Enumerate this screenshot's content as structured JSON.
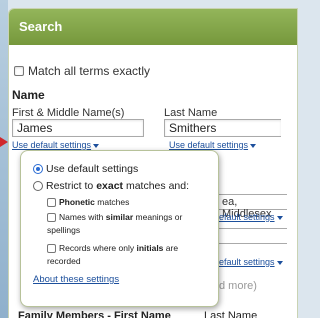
{
  "header": {
    "title": "Search"
  },
  "match_all": {
    "label": "Match all terms exactly",
    "checked": false
  },
  "section": {
    "title": "Name"
  },
  "first_name": {
    "label": "First & Middle Name(s)",
    "value": "James",
    "settings_link": "Use default settings"
  },
  "last_name": {
    "label": "Last Name",
    "value": "Smithers",
    "settings_link": "Use default settings"
  },
  "background": {
    "place_value": "ea, Middlesex",
    "settings_link_1": "efault settings",
    "settings_link_2": "efault settings",
    "more_text": "d more)",
    "family_label": "Family Members - First Name",
    "last_name_label": "Last Name"
  },
  "popup": {
    "option_default": "Use default settings",
    "option_restrict_prefix": "Restrict to ",
    "option_restrict_bold": "exact",
    "option_restrict_suffix": " matches and:",
    "phonetic_bold": "Phonetic",
    "phonetic_suffix": " matches",
    "similar_prefix": "Names with ",
    "similar_bold": "similar",
    "similar_suffix": " meanings or",
    "similar_cont": "spellings",
    "initials_prefix": "Records where only ",
    "initials_bold": "initials",
    "initials_suffix": " are",
    "initials_cont": "recorded",
    "about_link": "About these settings",
    "selected": "default"
  },
  "colors": {
    "header_green": "#84a64a",
    "link_blue": "#1c4f9c",
    "pointer_red": "#d0282c"
  }
}
